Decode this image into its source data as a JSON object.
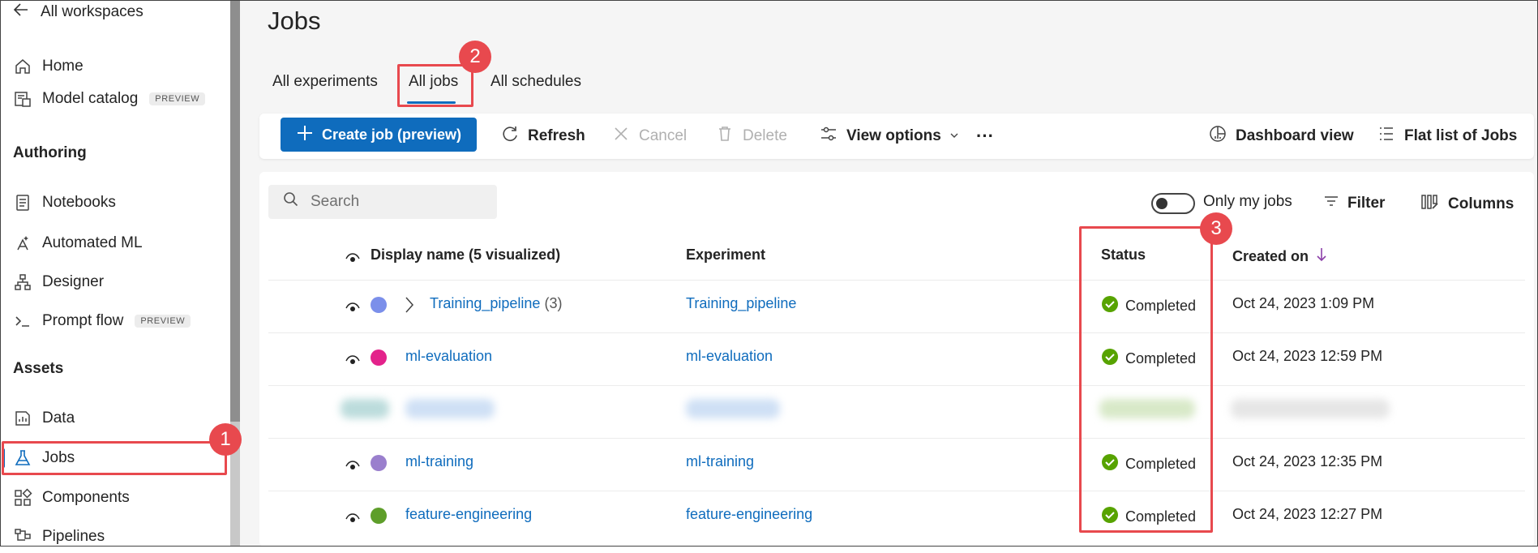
{
  "sidebar": {
    "back_label": "All workspaces",
    "items_top": [
      {
        "label": "Home",
        "icon": "home-icon"
      },
      {
        "label": "Model catalog",
        "badge": "PREVIEW",
        "icon": "catalog-icon"
      }
    ],
    "section_authoring": "Authoring",
    "items_authoring": [
      {
        "label": "Notebooks",
        "icon": "notebook-icon"
      },
      {
        "label": "Automated ML",
        "icon": "automl-icon"
      },
      {
        "label": "Designer",
        "icon": "designer-icon"
      },
      {
        "label": "Prompt flow",
        "badge": "PREVIEW",
        "icon": "prompt-icon"
      }
    ],
    "section_assets": "Assets",
    "items_assets": [
      {
        "label": "Data",
        "icon": "data-icon"
      },
      {
        "label": "Jobs",
        "icon": "flask-icon",
        "active": true
      },
      {
        "label": "Components",
        "icon": "components-icon"
      },
      {
        "label": "Pipelines",
        "icon": "pipelines-icon"
      }
    ]
  },
  "page": {
    "title": "Jobs",
    "tabs": [
      "All experiments",
      "All jobs",
      "All schedules"
    ],
    "active_tab": "All jobs"
  },
  "toolbar": {
    "create": "Create job (preview)",
    "refresh": "Refresh",
    "cancel": "Cancel",
    "delete": "Delete",
    "view_options": "View options",
    "more": "···",
    "dashboard": "Dashboard view",
    "flat_list": "Flat list of Jobs"
  },
  "filters": {
    "search_placeholder": "Search",
    "only_my_jobs": "Only my jobs",
    "filter": "Filter",
    "columns": "Columns"
  },
  "table": {
    "headers": {
      "display_name": "Display name (5 visualized)",
      "experiment": "Experiment",
      "status": "Status",
      "created_on": "Created on"
    },
    "rows": [
      {
        "name": "Training_pipeline",
        "child_count": "(3)",
        "experiment": "Training_pipeline",
        "status": "Completed",
        "created": "Oct 24, 2023 1:09 PM",
        "color": "#7b8fea",
        "expandable": true
      },
      {
        "name": "ml-evaluation",
        "experiment": "ml-evaluation",
        "status": "Completed",
        "created": "Oct 24, 2023 12:59 PM",
        "color": "#e3228b"
      },
      {
        "name": "ml-training",
        "experiment": "ml-training",
        "status": "Completed",
        "created": "Oct 24, 2023 12:35 PM",
        "color": "#9a7fcd"
      },
      {
        "name": "feature-engineering",
        "experiment": "feature-engineering",
        "status": "Completed",
        "created": "Oct 24, 2023 12:27 PM",
        "color": "#5e9e2a"
      }
    ]
  },
  "colors": {
    "accent": "#0f6cbd",
    "success": "#57a300",
    "callout": "#e8494e"
  },
  "callouts": [
    "1",
    "2",
    "3"
  ]
}
